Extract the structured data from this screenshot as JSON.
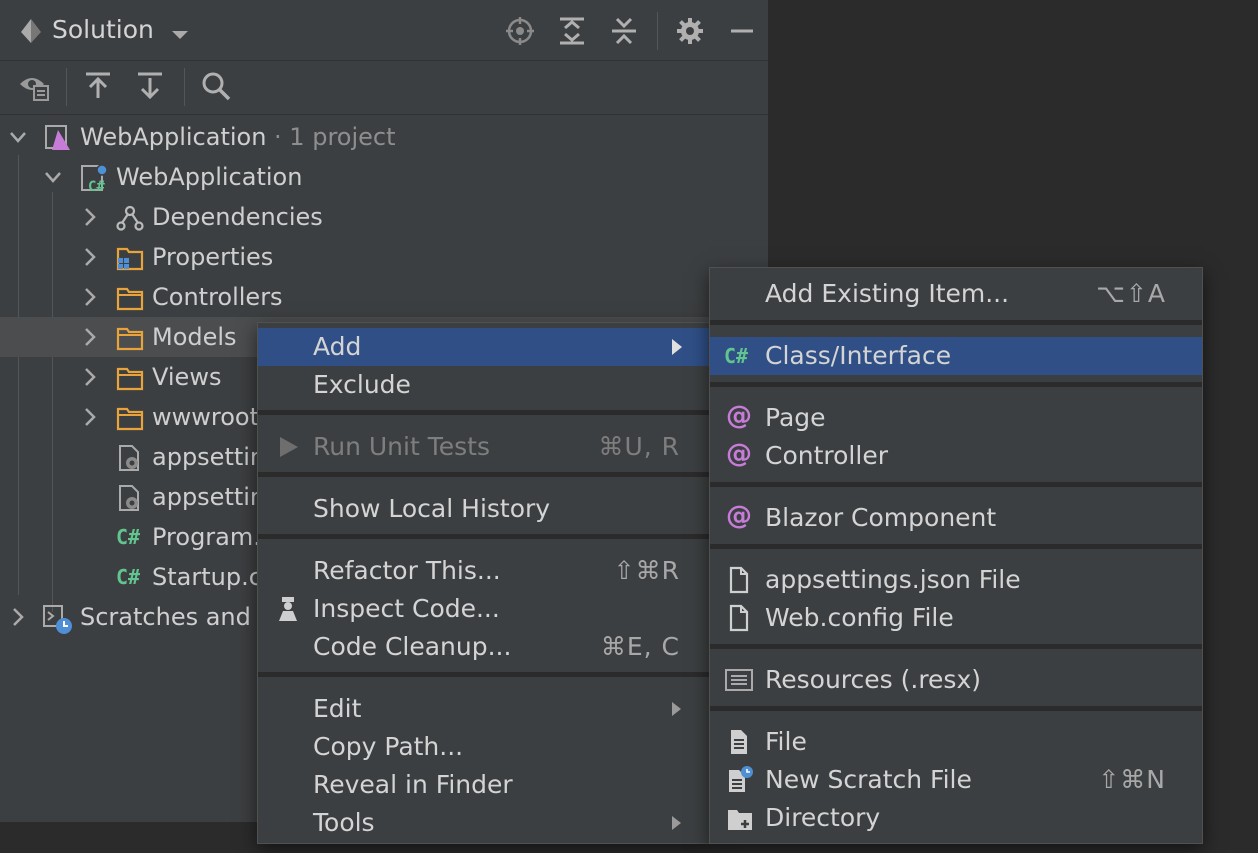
{
  "header": {
    "title": "Solution",
    "icons": [
      "locate-icon",
      "expand-all-icon",
      "collapse-all-icon",
      "gear-icon",
      "minimize-icon"
    ]
  },
  "toolbar": {
    "icons": [
      "show-files-icon",
      "move-up-icon",
      "move-down-icon",
      "search-icon"
    ]
  },
  "tree": {
    "solution": {
      "label": "WebApplication",
      "sub": " · 1 project"
    },
    "project": {
      "label": "WebApplication"
    },
    "items": [
      {
        "label": "Dependencies"
      },
      {
        "label": "Properties"
      },
      {
        "label": "Controllers"
      },
      {
        "label": "Models"
      },
      {
        "label": "Views"
      },
      {
        "label": "wwwroot"
      },
      {
        "label": "appsettings.json"
      },
      {
        "label": "appsettings.Development.json"
      },
      {
        "label": "Program.cs"
      },
      {
        "label": "Startup.cs"
      }
    ],
    "scratches": {
      "label": "Scratches and Consoles"
    }
  },
  "context_menu": {
    "add": "Add",
    "exclude": "Exclude",
    "run_unit_tests": "Run Unit Tests",
    "run_unit_tests_shortcut": "⌘U, R",
    "show_local_history": "Show Local History",
    "refactor_this": "Refactor This...",
    "refactor_this_shortcut": "⇧⌘R",
    "inspect_code": "Inspect Code...",
    "code_cleanup": "Code Cleanup...",
    "code_cleanup_shortcut": "⌘E, C",
    "edit": "Edit",
    "copy_path": "Copy Path...",
    "reveal_in_finder": "Reveal in Finder",
    "tools": "Tools"
  },
  "add_submenu": {
    "add_existing_item": "Add Existing Item...",
    "add_existing_item_shortcut": "⌥⇧A",
    "class_interface": "Class/Interface",
    "page": "Page",
    "controller": "Controller",
    "blazor_component": "Blazor Component",
    "appsettings_json_file": "appsettings.json File",
    "web_config_file": "Web.config File",
    "resources_resx": "Resources (.resx)",
    "file": "File",
    "new_scratch_file": "New Scratch File",
    "new_scratch_file_shortcut": "⇧⌘N",
    "directory": "Directory"
  },
  "colors": {
    "highlight": "#2f4f86",
    "panel": "#3c3f41",
    "folder": "#e8a33d",
    "csharp": "#62c58f"
  }
}
